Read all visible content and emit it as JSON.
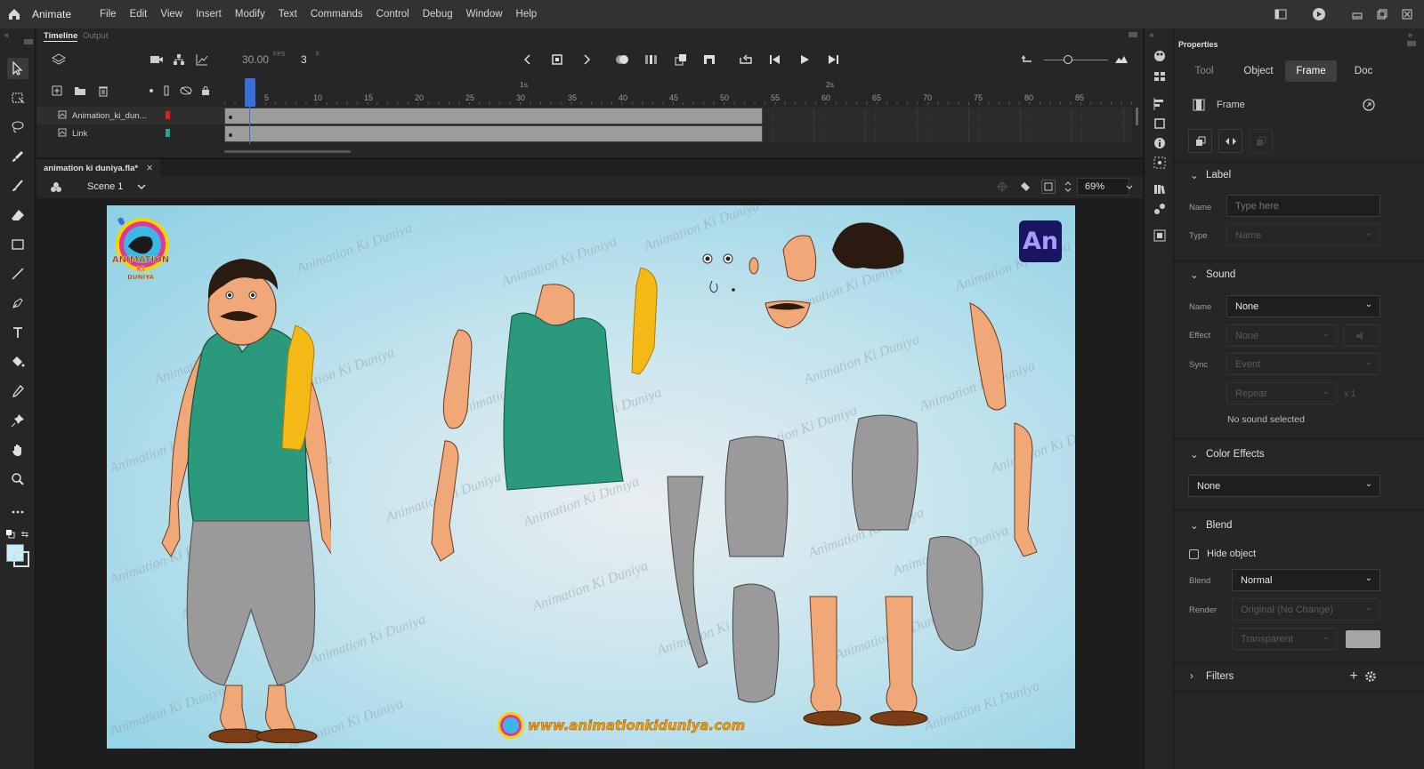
{
  "app": {
    "name": "Animate"
  },
  "menu": [
    "File",
    "Edit",
    "View",
    "Insert",
    "Modify",
    "Text",
    "Commands",
    "Control",
    "Debug",
    "Window",
    "Help"
  ],
  "timeline": {
    "tabs": [
      "Timeline",
      "Output"
    ],
    "fps": "30.00",
    "fps_unit": "FPS",
    "frame": "3",
    "frame_unit": "F",
    "ruler_ticks": [
      "5",
      "10",
      "15",
      "20",
      "25",
      "30",
      "35",
      "40",
      "45",
      "50",
      "55",
      "60",
      "65",
      "70",
      "75",
      "80",
      "85"
    ],
    "seconds": [
      "1s",
      "2s"
    ],
    "layers": [
      {
        "name": "Animation_ki_dun...",
        "color": "#e0201c"
      },
      {
        "name": "Link",
        "color": "#1fa897"
      }
    ]
  },
  "document": {
    "tab_title": "animation ki duniya.fla*",
    "scene": "Scene 1",
    "zoom": "69%"
  },
  "stage": {
    "watermark": "Animation Ki Duniya",
    "logo_text": "An",
    "website": "www.animationkiduniya.com",
    "logo_badge": "ANIMATION KI DUNIYA"
  },
  "properties": {
    "title": "Properties",
    "tabs": [
      "Tool",
      "Object",
      "Frame",
      "Doc"
    ],
    "active_tab": "Frame",
    "header": "Frame",
    "label_section": {
      "title": "Label",
      "name_label": "Name",
      "name_placeholder": "Type here",
      "type_label": "Type",
      "type_value": "Name"
    },
    "sound_section": {
      "title": "Sound",
      "name_label": "Name",
      "name_value": "None",
      "effect_label": "Effect",
      "effect_value": "None",
      "sync_label": "Sync",
      "sync_value": "Event",
      "repeat_value": "Repeat",
      "repeat_count": "x 1",
      "status": "No sound selected"
    },
    "color_effects": {
      "title": "Color Effects",
      "value": "None"
    },
    "blend_section": {
      "title": "Blend",
      "hide_object": "Hide object",
      "blend_label": "Blend",
      "blend_value": "Normal",
      "render_label": "Render",
      "render_value": "Original (No Change)",
      "transparent_value": "Transparent"
    },
    "filters": {
      "title": "Filters"
    }
  },
  "colors": {
    "accent": "#3a6fd8",
    "stage_bg": "#8cd0e4",
    "logo_bg": "#1a1560",
    "logo_fg": "#a79bff"
  }
}
